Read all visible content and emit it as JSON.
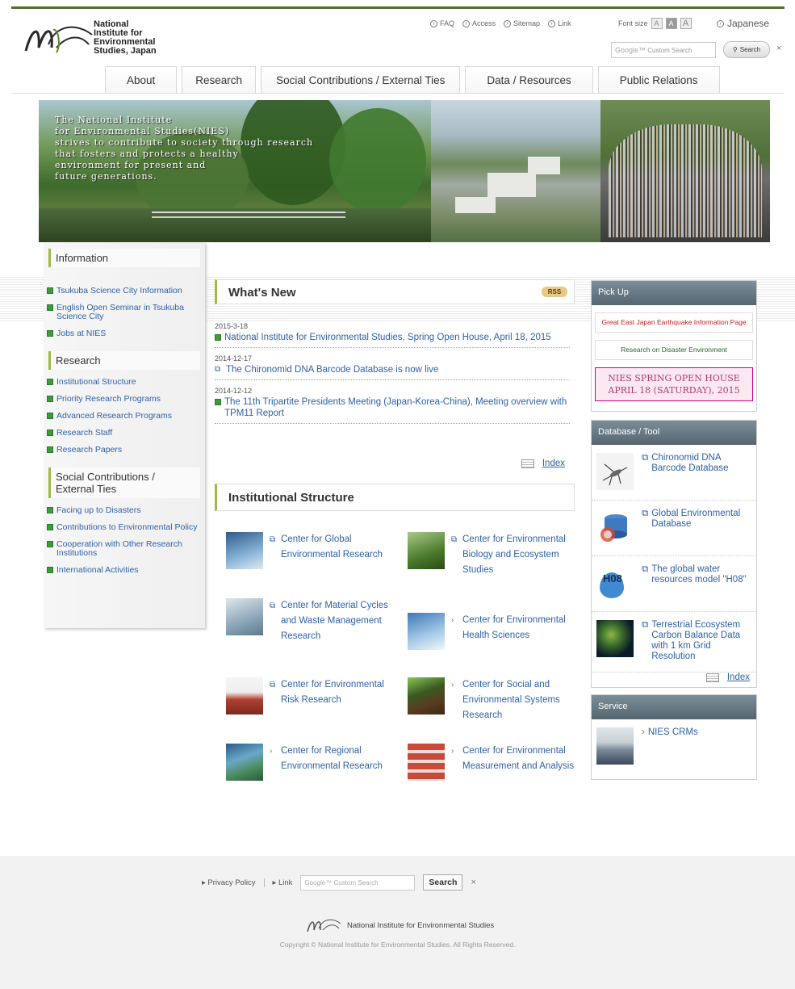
{
  "header": {
    "logo_lines": [
      "National",
      "Institute for",
      "Environmental",
      "Studies, Japan"
    ],
    "util_links": [
      "FAQ",
      "Access",
      "Sitemap",
      "Link"
    ],
    "font_size_label": "Font size",
    "font_size_options": [
      "A",
      "A",
      "A"
    ],
    "language": "Japanese",
    "search": {
      "google_label": "Google™",
      "placeholder": "Custom Search",
      "button": "Search",
      "clear": "×"
    }
  },
  "nav": [
    "About",
    "Research",
    "Social Contributions / External Ties",
    "Data / Resources",
    "Public Relations"
  ],
  "banner": {
    "text_lines": [
      "The National Institute",
      "for Environmental Studies(NIES)",
      "strives to contribute to society through research",
      "that fosters and protects a healthy",
      "environment for present and",
      "future generations."
    ]
  },
  "left": {
    "info_title": "Information",
    "info_items": [
      "Tsukuba Science City Information",
      "English Open Seminar in Tsukuba Science City",
      "Jobs at NIES"
    ],
    "research_title": "Research",
    "research_items": [
      "Institutional Structure",
      "Priority Research Programs",
      "Advanced Research Programs",
      "Research Staff",
      "Research Papers"
    ],
    "social_title": "Social Contributions / External Ties",
    "social_items": [
      "Facing up to Disasters",
      "Contributions to Environmental Policy",
      "Cooperation with Other Research Institutions",
      "International Activities"
    ]
  },
  "whats_new": {
    "title": "What's New",
    "rss": "RSS",
    "items": [
      {
        "date": "2015-3-18",
        "text": "National Institute for Environmental Studies, Spring Open House, April 18, 2015",
        "icon": "square-bullet"
      },
      {
        "date": "2014-12-17",
        "text": "The Chironomid DNA Barcode Database is now live",
        "icon": "external-window"
      },
      {
        "date": "2014-12-12",
        "text": "The 11th Tripartite Presidents Meeting (Japan-Korea-China), Meeting overview with TPM11 Report",
        "icon": "square-bullet"
      }
    ],
    "index": "Index"
  },
  "institutional": {
    "title": "Institutional Structure",
    "centers": [
      {
        "label": "Center for Global Environmental Research",
        "icon": "external-window",
        "thumb_color": "#4a7fae"
      },
      {
        "label": "Center for Environmental Biology and Ecosystem Studies",
        "icon": "external-window",
        "thumb_color": "#5a8a3e"
      },
      {
        "label": "Center for Material Cycles and Waste Management Research",
        "icon": "external-window",
        "thumb_color": "#8aa4b8"
      },
      {
        "label": "Center for Environmental Health Sciences",
        "icon": "chevron-right",
        "thumb_color": "#6fa0d2"
      },
      {
        "label": "Center for Environmental Risk Research",
        "icon": "external-window",
        "thumb_color": "#b04030"
      },
      {
        "label": "Center for Social and Environmental Systems Research",
        "icon": "chevron-right",
        "thumb_color": "#5a4a30"
      },
      {
        "label": "Center for Regional Environmental Research",
        "icon": "chevron-right",
        "thumb_color": "#4a8a5a"
      },
      {
        "label": "Center for Environmental Measurement and Analysis",
        "icon": "chevron-right",
        "thumb_color": "#c84a3a"
      }
    ]
  },
  "right": {
    "pickup_title": "Pick Up",
    "pickup_quake": "Great East Japan Earthquake Information Page",
    "pickup_disaster": "Research on Disaster Environment",
    "pickup_spring_1": "NIES SPRING OPEN HOUSE",
    "pickup_spring_2": "APRIL 18 (SATURDAY), 2015",
    "db_title": "Database / Tool",
    "db_items": [
      {
        "label": "Chironomid DNA Barcode Database"
      },
      {
        "label": "Global Environmental Database"
      },
      {
        "label": "The global water resources model \"H08\""
      },
      {
        "label": "Terrestrial Ecosystem Carbon Balance Data with 1 km Grid Resolution"
      }
    ],
    "h08_text": "H08",
    "db_index": "Index",
    "service_title": "Service",
    "service_item": "NIES CRMs"
  },
  "footer": {
    "privacy": "Privacy Policy",
    "link": "Link",
    "google_label": "Google™",
    "search_placeholder": "Custom Search",
    "search_button": "Search",
    "clear": "×",
    "org": "National Institute for Environmental Studies",
    "copyright": "Copyright © National Institute for Environmental Studies. All Rights Reserved."
  },
  "colors": {
    "accent_green": "#9dbb48",
    "link_blue": "#2f61a8",
    "panel_head": "#5f7079",
    "header_rule": "#556b2f"
  }
}
